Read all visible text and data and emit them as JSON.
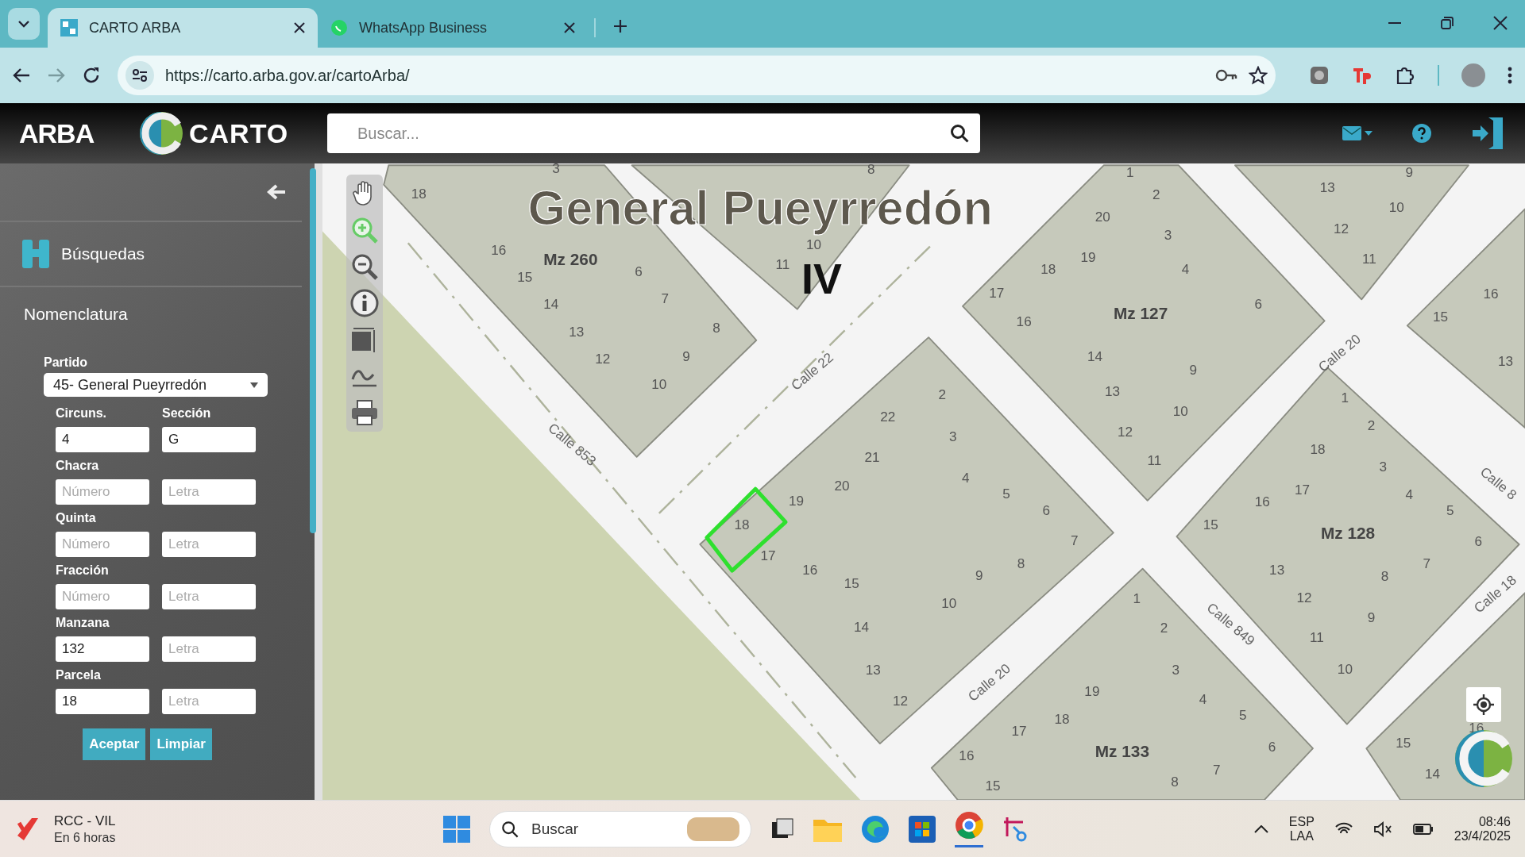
{
  "browser": {
    "tabs": [
      {
        "title": "CARTO ARBA",
        "selected": true
      },
      {
        "title": "WhatsApp Business",
        "selected": false
      }
    ],
    "url": "https://carto.arba.gov.ar/cartoArba/"
  },
  "header": {
    "logo": "ARBA",
    "brand": "CARTO",
    "search": {
      "placeholder": "Buscar..."
    }
  },
  "sidebar": {
    "section": "Búsquedas",
    "heading": "Nomenclatura",
    "partido": {
      "label": "Partido",
      "value": "45- General Pueyrredón"
    },
    "rows": [
      {
        "labels": [
          "Circuns.",
          "Sección"
        ],
        "inputs": [
          {
            "value": "4"
          },
          {
            "value": "G"
          }
        ]
      },
      {
        "labels": [
          "Chacra"
        ],
        "inputs": [
          {
            "placeholder": "Número"
          },
          {
            "placeholder": "Letra"
          }
        ]
      },
      {
        "labels": [
          "Quinta"
        ],
        "inputs": [
          {
            "placeholder": "Número"
          },
          {
            "placeholder": "Letra"
          }
        ]
      },
      {
        "labels": [
          "Fracción"
        ],
        "inputs": [
          {
            "placeholder": "Número"
          },
          {
            "placeholder": "Letra"
          }
        ]
      },
      {
        "labels": [
          "Manzana"
        ],
        "inputs": [
          {
            "value": "132"
          },
          {
            "placeholder": "Letra"
          }
        ]
      },
      {
        "labels": [
          "Parcela"
        ],
        "inputs": [
          {
            "value": "18"
          },
          {
            "placeholder": "Letra"
          }
        ]
      }
    ],
    "buttons": [
      "Aceptar",
      "Limpiar"
    ]
  },
  "map": {
    "title": "General Pueyrredón",
    "section": "IV",
    "labels": [
      {
        "kind": "parcel",
        "text": "18"
      },
      {
        "kind": "parcel",
        "text": "3"
      },
      {
        "kind": "parcel",
        "text": "16"
      },
      {
        "kind": "block",
        "text": "Mz 260"
      },
      {
        "kind": "parcel",
        "text": "15"
      },
      {
        "kind": "parcel",
        "text": "6"
      },
      {
        "kind": "parcel",
        "text": "14"
      },
      {
        "kind": "parcel",
        "text": "7"
      },
      {
        "kind": "parcel",
        "text": "13"
      },
      {
        "kind": "parcel",
        "text": "8"
      },
      {
        "kind": "parcel",
        "text": "12"
      },
      {
        "kind": "parcel",
        "text": "9"
      },
      {
        "kind": "parcel",
        "text": "10"
      },
      {
        "kind": "parcel",
        "text": "8"
      },
      {
        "kind": "parcel",
        "text": "10"
      },
      {
        "kind": "parcel",
        "text": "11"
      },
      {
        "kind": "parcel",
        "text": "22"
      },
      {
        "kind": "parcel",
        "text": "2"
      },
      {
        "kind": "parcel",
        "text": "3"
      },
      {
        "kind": "parcel",
        "text": "21"
      },
      {
        "kind": "parcel",
        "text": "4"
      },
      {
        "kind": "parcel",
        "text": "20"
      },
      {
        "kind": "parcel",
        "text": "19"
      },
      {
        "kind": "parcel",
        "text": "5"
      },
      {
        "kind": "parcel",
        "text": "6"
      },
      {
        "kind": "parcel",
        "text": "18"
      },
      {
        "kind": "parcel",
        "text": "7"
      },
      {
        "kind": "parcel",
        "text": "17"
      },
      {
        "kind": "parcel",
        "text": "8"
      },
      {
        "kind": "parcel",
        "text": "16"
      },
      {
        "kind": "parcel",
        "text": "9"
      },
      {
        "kind": "parcel",
        "text": "15"
      },
      {
        "kind": "parcel",
        "text": "10"
      },
      {
        "kind": "parcel",
        "text": "14"
      },
      {
        "kind": "parcel",
        "text": "13"
      },
      {
        "kind": "parcel",
        "text": "12"
      },
      {
        "kind": "parcel",
        "text": "1"
      },
      {
        "kind": "parcel",
        "text": "2"
      },
      {
        "kind": "parcel",
        "text": "20"
      },
      {
        "kind": "parcel",
        "text": "3"
      },
      {
        "kind": "parcel",
        "text": "19"
      },
      {
        "kind": "parcel",
        "text": "18"
      },
      {
        "kind": "parcel",
        "text": "4"
      },
      {
        "kind": "parcel",
        "text": "17"
      },
      {
        "kind": "parcel",
        "text": "6"
      },
      {
        "kind": "block",
        "text": "Mz 127"
      },
      {
        "kind": "parcel",
        "text": "16"
      },
      {
        "kind": "parcel",
        "text": "14"
      },
      {
        "kind": "parcel",
        "text": "9"
      },
      {
        "kind": "parcel",
        "text": "13"
      },
      {
        "kind": "parcel",
        "text": "10"
      },
      {
        "kind": "parcel",
        "text": "12"
      },
      {
        "kind": "parcel",
        "text": "11"
      },
      {
        "kind": "parcel",
        "text": "9"
      },
      {
        "kind": "parcel",
        "text": "13"
      },
      {
        "kind": "parcel",
        "text": "10"
      },
      {
        "kind": "parcel",
        "text": "12"
      },
      {
        "kind": "parcel",
        "text": "11"
      },
      {
        "kind": "parcel",
        "text": "16"
      },
      {
        "kind": "parcel",
        "text": "15"
      },
      {
        "kind": "parcel",
        "text": "13"
      },
      {
        "kind": "parcel",
        "text": "1"
      },
      {
        "kind": "parcel",
        "text": "2"
      },
      {
        "kind": "parcel",
        "text": "18"
      },
      {
        "kind": "parcel",
        "text": "3"
      },
      {
        "kind": "parcel",
        "text": "17"
      },
      {
        "kind": "parcel",
        "text": "4"
      },
      {
        "kind": "parcel",
        "text": "16"
      },
      {
        "kind": "parcel",
        "text": "5"
      },
      {
        "kind": "parcel",
        "text": "15"
      },
      {
        "kind": "block",
        "text": "Mz 128"
      },
      {
        "kind": "parcel",
        "text": "6"
      },
      {
        "kind": "parcel",
        "text": "7"
      },
      {
        "kind": "parcel",
        "text": "13"
      },
      {
        "kind": "parcel",
        "text": "8"
      },
      {
        "kind": "parcel",
        "text": "12"
      },
      {
        "kind": "parcel",
        "text": "9"
      },
      {
        "kind": "parcel",
        "text": "11"
      },
      {
        "kind": "parcel",
        "text": "10"
      },
      {
        "kind": "parcel",
        "text": "1"
      },
      {
        "kind": "parcel",
        "text": "2"
      },
      {
        "kind": "parcel",
        "text": "3"
      },
      {
        "kind": "parcel",
        "text": "19"
      },
      {
        "kind": "parcel",
        "text": "4"
      },
      {
        "kind": "parcel",
        "text": "17"
      },
      {
        "kind": "parcel",
        "text": "18"
      },
      {
        "kind": "parcel",
        "text": "5"
      },
      {
        "kind": "parcel",
        "text": "16"
      },
      {
        "kind": "parcel",
        "text": "16"
      },
      {
        "kind": "block",
        "text": "Mz 133"
      },
      {
        "kind": "parcel",
        "text": "6"
      },
      {
        "kind": "parcel",
        "text": "15"
      },
      {
        "kind": "parcel",
        "text": "15"
      },
      {
        "kind": "parcel",
        "text": "8"
      },
      {
        "kind": "parcel",
        "text": "7"
      },
      {
        "kind": "parcel",
        "text": "14"
      },
      {
        "kind": "street",
        "text": "Calle 22"
      },
      {
        "kind": "street",
        "text": "Calle 853"
      },
      {
        "kind": "street",
        "text": "Calle 20"
      },
      {
        "kind": "street",
        "text": "Calle 849"
      },
      {
        "kind": "street",
        "text": "Calle 20"
      },
      {
        "kind": "street",
        "text": "Calle 8"
      },
      {
        "kind": "street",
        "text": "Calle 18"
      }
    ]
  },
  "taskbar": {
    "event": {
      "title": "RCC - VIL",
      "time": "En 6 horas"
    },
    "search": "Buscar",
    "language": [
      "ESP",
      "LAA"
    ],
    "clock": {
      "time": "08:46",
      "date": "23/4/2025"
    }
  }
}
